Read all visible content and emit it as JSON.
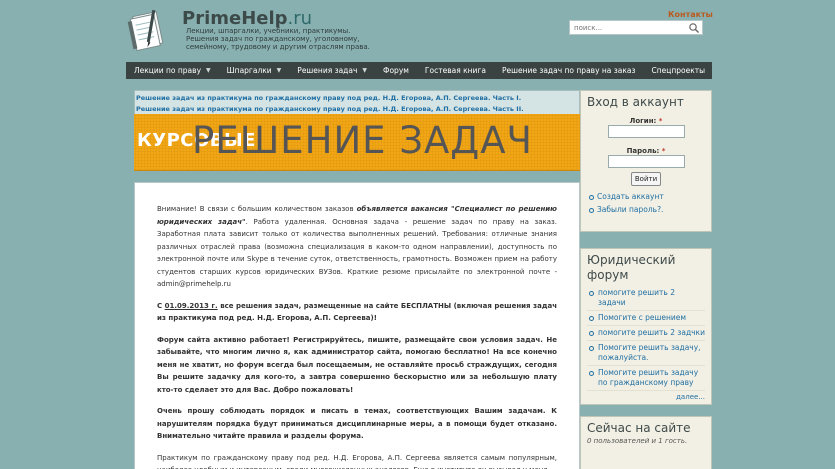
{
  "header": {
    "site_name": "PrimeHelp",
    "site_tld": ".ru",
    "tagline": "Лекции, шпаргалки, учебники, практикумы. Решения задач по гражданскому, уголовному, семейному, трудовому и другим отраслям права.",
    "contacts_label": "Контакты",
    "search_placeholder": "поиск...",
    "icon": "notebook-logo-icon"
  },
  "nav": {
    "items": [
      {
        "label": "Лекции по праву",
        "has_dropdown": true
      },
      {
        "label": "Шпаргалки",
        "has_dropdown": true
      },
      {
        "label": "Решения задач",
        "has_dropdown": true
      },
      {
        "label": "Форум",
        "has_dropdown": false
      },
      {
        "label": "Гостевая книга",
        "has_dropdown": false
      },
      {
        "label": "Решение задач по праву на заказ",
        "has_dropdown": false
      },
      {
        "label": "Спецпроекты",
        "has_dropdown": false
      }
    ]
  },
  "news": {
    "links": [
      "Решение задач из практикума по гражданскому праву под ред. Н.Д. Егорова, А.П. Сергеева. Часть I.",
      "Решение задач из практикума по гражданскому праву под ред. Н.Д. Егорова, А.П. Сергеева. Часть II."
    ]
  },
  "banner": {
    "small_text": "КУРСОВЫЕ",
    "big_text": "РЕШЕНИЕ ЗАДАЧ"
  },
  "content": {
    "p1_a": "Внимание! В связи с большим количеством заказов ",
    "p1_b": "объявляется вакансия \"Специалист по решению юридических задач\"",
    "p1_c": ". Работа удаленная. Основная задача - решение задач по праву на заказ. Заработная плата зависит только от количества выполненных решений. Требования: отличные знания различных отраслей права (возможна специализация в каком-то одном направлении), доступность по электронной почте или Skype в течение суток, ответственность, грамотность. Возможен прием на работу студентов старших курсов юридических ВУЗов. Краткие резюме присылайте по электронной почте - admin@primehelp.ru",
    "p2_a": "С ",
    "p2_date": "01.09.2013 г.",
    "p2_b": " все решения задач, размещенные на сайте БЕСПЛАТНЫ (включая решения задач из практикума под ред. Н.Д. Егорова, А.П. Сергеева)!",
    "p3": "Форум сайта активно работает! Регистрируйтесь, пишите, размещайте свои условия задач. Не забывайте, что многим лично я, как администратор сайта, помогаю бесплатно! На все конечно меня не хватит, но форум всегда был посещаемым, не оставляйте просьб страждущих, сегодня Вы решите задачку для кого-то, а завтра совершенно бескорыстно или за небольшую плату кто-то сделает это для Вас. Добро пожаловать!",
    "p4": "Очень прошу соблюдать порядок и писать в темах, соответствующих Вашим задачам. К нарушителям порядка будут приниматься дисциплинарные меры, а в помощи будет отказано. Внимательно читайте правила и разделы форума.",
    "p5": "Практикум по гражданскому праву под ред. Н.Д. Егорова, А.П. Сергеева является самым популярным, наиболее удобным и интересным, среди многочисленных аналогов. Еще в институте он вызывал у меня"
  },
  "login": {
    "title": "Вход в аккаунт",
    "login_label": "Логин:",
    "password_label": "Пароль:",
    "required_mark": "*",
    "button_label": "Войти",
    "links": [
      "Создать аккаунт",
      "Забыли пароль?."
    ]
  },
  "forum": {
    "title": "Юридический форум",
    "items": [
      "помогите решить 2 задачи",
      "Помогите с решением",
      "помогите решить 2 задчки",
      "Помогите решить задачу, пожалуйста.",
      "Помогите решить задачу по гражданскому праву"
    ],
    "more_label": "далее..."
  },
  "online": {
    "title": "Сейчас на сайте",
    "text": "0 пользователей и 1 гость."
  }
}
